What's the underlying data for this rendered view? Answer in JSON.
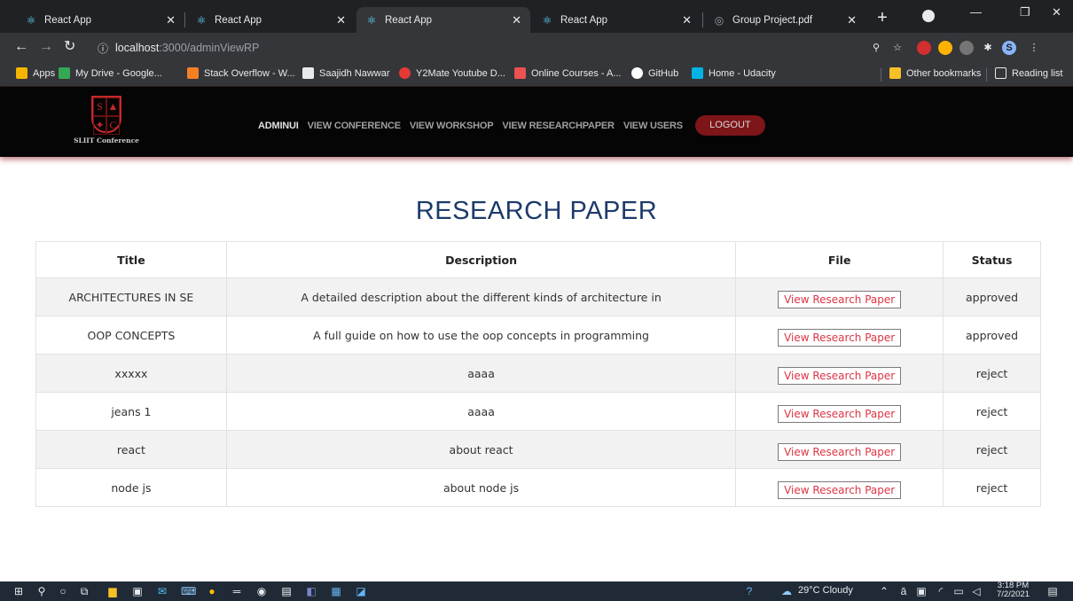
{
  "browser": {
    "tabs": [
      {
        "label": "React App",
        "icon": "react-icon",
        "active": false
      },
      {
        "label": "React App",
        "icon": "react-icon",
        "active": false
      },
      {
        "label": "React App",
        "icon": "react-icon",
        "active": true
      },
      {
        "label": "React App",
        "icon": "react-icon",
        "active": false
      },
      {
        "label": "Group Project.pdf",
        "icon": "globe-icon",
        "active": false
      }
    ],
    "url_host": "localhost",
    "url_path": ":3000/adminViewRP",
    "bookmarks": [
      {
        "label": "Apps",
        "icon": "apps-grid-icon",
        "color": "#f4b400"
      },
      {
        "label": "My Drive - Google...",
        "icon": "google-drive-icon",
        "color": "#34a853"
      },
      {
        "label": "Stack Overflow - W...",
        "icon": "stackoverflow-icon",
        "color": "#f48024"
      },
      {
        "label": "Saajidh Nawwar",
        "icon": "bookmark-page-icon",
        "color": "#e8eaed"
      },
      {
        "label": "Y2Mate Youtube D...",
        "icon": "y2mate-icon",
        "color": "#e53935"
      },
      {
        "label": "Online Courses - A...",
        "icon": "udemy-icon",
        "color": "#ec5252"
      },
      {
        "label": "GitHub",
        "icon": "github-icon",
        "color": "#ffffff"
      },
      {
        "label": "Home - Udacity",
        "icon": "udacity-icon",
        "color": "#02b3e4"
      }
    ],
    "other_bookmarks": "Other bookmarks",
    "reading_list": "Reading list"
  },
  "site": {
    "brand": "SLIIT Conference",
    "logo_letters": [
      "S",
      "",
      "",
      "C"
    ],
    "nav": [
      "ADMINUI",
      "VIEW CONFERENCE",
      "VIEW WORKSHOP",
      "VIEW RESEARCHPAPER",
      "VIEW USERS"
    ],
    "logout": "LOGOUT"
  },
  "page": {
    "title": "RESEARCH PAPER",
    "columns": [
      "Title",
      "Description",
      "File",
      "Status"
    ],
    "rows": [
      {
        "title": "ARCHITECTURES IN SE",
        "description": "A detailed description about the different kinds of architecture in",
        "file": "View Research Paper",
        "status": "approved"
      },
      {
        "title": "OOP CONCEPTS",
        "description": "A full guide on how to use the oop concepts in programming",
        "file": "View Research Paper",
        "status": "approved"
      },
      {
        "title": "xxxxx",
        "description": "aaaa",
        "file": "View Research Paper",
        "status": "reject"
      },
      {
        "title": "jeans 1",
        "description": "aaaa",
        "file": "View Research Paper",
        "status": "reject"
      },
      {
        "title": "react",
        "description": "about react",
        "file": "View Research Paper",
        "status": "reject"
      },
      {
        "title": "node js",
        "description": "about node js",
        "file": "View Research Paper",
        "status": "reject"
      }
    ]
  },
  "taskbar": {
    "weather": "29°C  Cloudy",
    "time": "3:18 PM",
    "date": "7/2/2021"
  },
  "colors": {
    "accent_red": "#7d1519",
    "title_blue": "#1d3a6b",
    "button_text": "#dc3545"
  }
}
